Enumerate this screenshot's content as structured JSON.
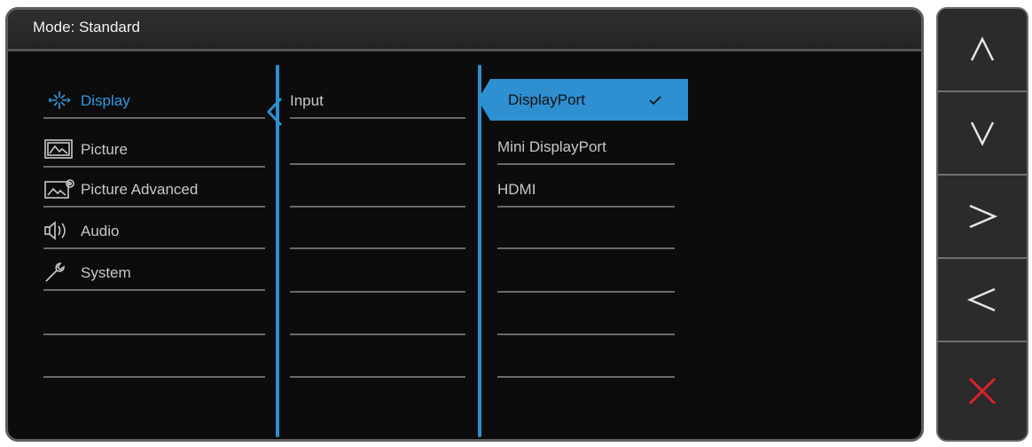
{
  "header": {
    "mode_label": "Mode: Standard"
  },
  "menu": {
    "items": [
      {
        "label": "Display",
        "icon": "display-icon",
        "active": true
      },
      {
        "label": "Picture",
        "icon": "picture-icon"
      },
      {
        "label": "Picture Advanced",
        "icon": "picture-advanced-icon"
      },
      {
        "label": "Audio",
        "icon": "speaker-icon"
      },
      {
        "label": "System",
        "icon": "wrench-icon"
      },
      {
        "label": ""
      },
      {
        "label": ""
      }
    ]
  },
  "submenu": {
    "items": [
      {
        "label": "Input"
      },
      {
        "label": ""
      },
      {
        "label": ""
      },
      {
        "label": ""
      },
      {
        "label": ""
      },
      {
        "label": ""
      },
      {
        "label": ""
      }
    ]
  },
  "options": {
    "selected": "DisplayPort",
    "items": [
      {
        "label": "DisplayPort"
      },
      {
        "label": "Mini DisplayPort"
      },
      {
        "label": "HDMI"
      },
      {
        "label": ""
      },
      {
        "label": ""
      },
      {
        "label": ""
      },
      {
        "label": ""
      }
    ]
  },
  "rail": {
    "buttons": [
      {
        "icon": "chevron-up-icon"
      },
      {
        "icon": "chevron-down-icon"
      },
      {
        "icon": "chevron-right-icon"
      },
      {
        "icon": "chevron-left-icon"
      },
      {
        "icon": "close-icon"
      }
    ]
  },
  "colors": {
    "accent": "#2e8fd1",
    "close": "#e0202a",
    "panel": "#0c0c0c"
  }
}
